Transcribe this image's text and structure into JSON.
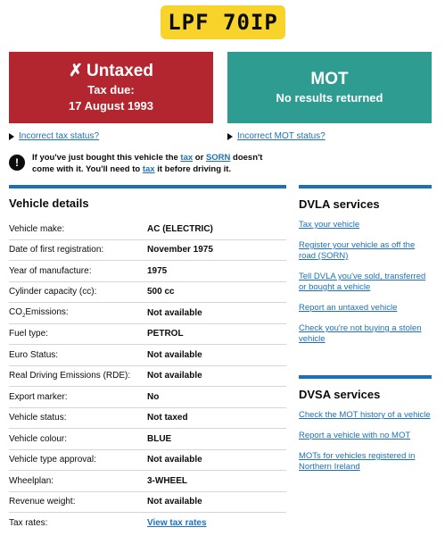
{
  "registration": "LPF 70IP",
  "tax": {
    "mark": "✗",
    "title": "Untaxed",
    "due_label": "Tax due:",
    "due_date": "17 August 1993",
    "incorrect_link": "Incorrect tax status?",
    "color": "#b4262f"
  },
  "mot": {
    "title": "MOT",
    "subtitle": "No results returned",
    "incorrect_link": "Incorrect MOT status?",
    "color": "#2e9c91"
  },
  "warning": {
    "part1": "If you've just bought this vehicle the ",
    "link_tax": "tax",
    "part2": " or ",
    "link_sorn": "SORN",
    "part3": " doesn't come with it. You'll need to ",
    "link_tax2": "tax",
    "part4": " it before driving it."
  },
  "details": {
    "heading": "Vehicle details",
    "rows": [
      {
        "key": "Vehicle make:",
        "value": "AC (ELECTRIC)"
      },
      {
        "key": "Date of first registration:",
        "value": "November 1975"
      },
      {
        "key": "Year of manufacture:",
        "value": "1975"
      },
      {
        "key": "Cylinder capacity (cc):",
        "value": "500 cc"
      },
      {
        "key_prefix": "CO",
        "key_sub": "2",
        "key_suffix": "Emissions:",
        "value": "Not available"
      },
      {
        "key": "Fuel type:",
        "value": "PETROL"
      },
      {
        "key": "Euro Status:",
        "value": "Not available"
      },
      {
        "key": "Real Driving Emissions (RDE):",
        "value": "Not available"
      },
      {
        "key": "Export marker:",
        "value": "No"
      },
      {
        "key": "Vehicle status:",
        "value": "Not taxed"
      },
      {
        "key": "Vehicle colour:",
        "value": "BLUE"
      },
      {
        "key": "Vehicle type approval:",
        "value": "Not available"
      },
      {
        "key": "Wheelplan:",
        "value": "3-WHEEL"
      },
      {
        "key": "Revenue weight:",
        "value": "Not available"
      },
      {
        "key": "Tax rates:",
        "value": "View tax rates"
      }
    ]
  },
  "dvla": {
    "heading": "DVLA services",
    "links": [
      "Tax your vehicle",
      "Register your vehicle as off the road (SORN)",
      "Tell DVLA you've sold, transferred or bought a vehicle",
      "Report an untaxed vehicle",
      "Check you're not buying a stolen vehicle"
    ]
  },
  "dvsa": {
    "heading": "DVSA services",
    "links": [
      "Check the MOT history of a vehicle",
      "Report a vehicle with no MOT",
      "MOTs for vehicles registered in Northern Ireland"
    ]
  },
  "colors": {
    "plate": "#f8d32a",
    "link": "#1d70b8",
    "text": "#0b0c0c"
  }
}
